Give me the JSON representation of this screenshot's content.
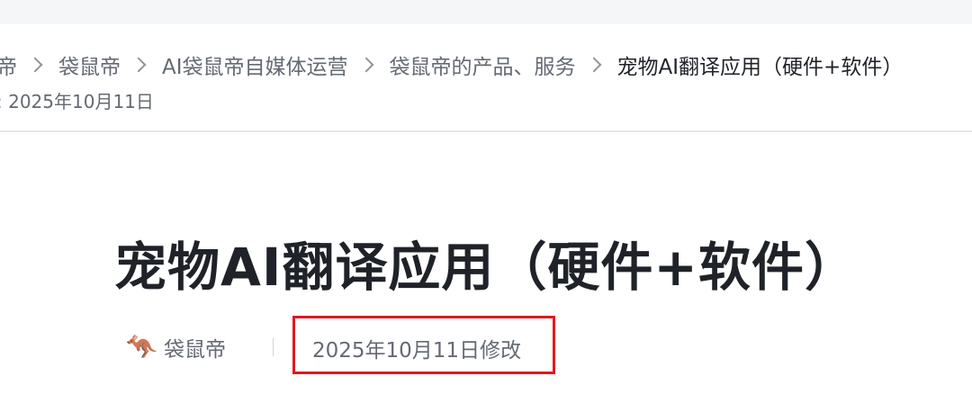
{
  "breadcrumb": {
    "items": [
      {
        "label": "帝"
      },
      {
        "label": "袋鼠帝"
      },
      {
        "label": "AI袋鼠帝自媒体运营"
      },
      {
        "label": "袋鼠帝的产品、服务"
      },
      {
        "label": "宠物AI翻译应用（硬件+软件）"
      }
    ]
  },
  "header": {
    "updated_text": ": 2025年10月11日"
  },
  "document": {
    "title": "宠物AI翻译应用（硬件+软件）",
    "author": "袋鼠帝",
    "avatar_icon": "kangaroo-boxing-icon",
    "modified": "2025年10月11日修改"
  },
  "colors": {
    "highlight_box": "#e0191f",
    "muted_text": "#646a73",
    "primary_text": "#1f2329"
  }
}
